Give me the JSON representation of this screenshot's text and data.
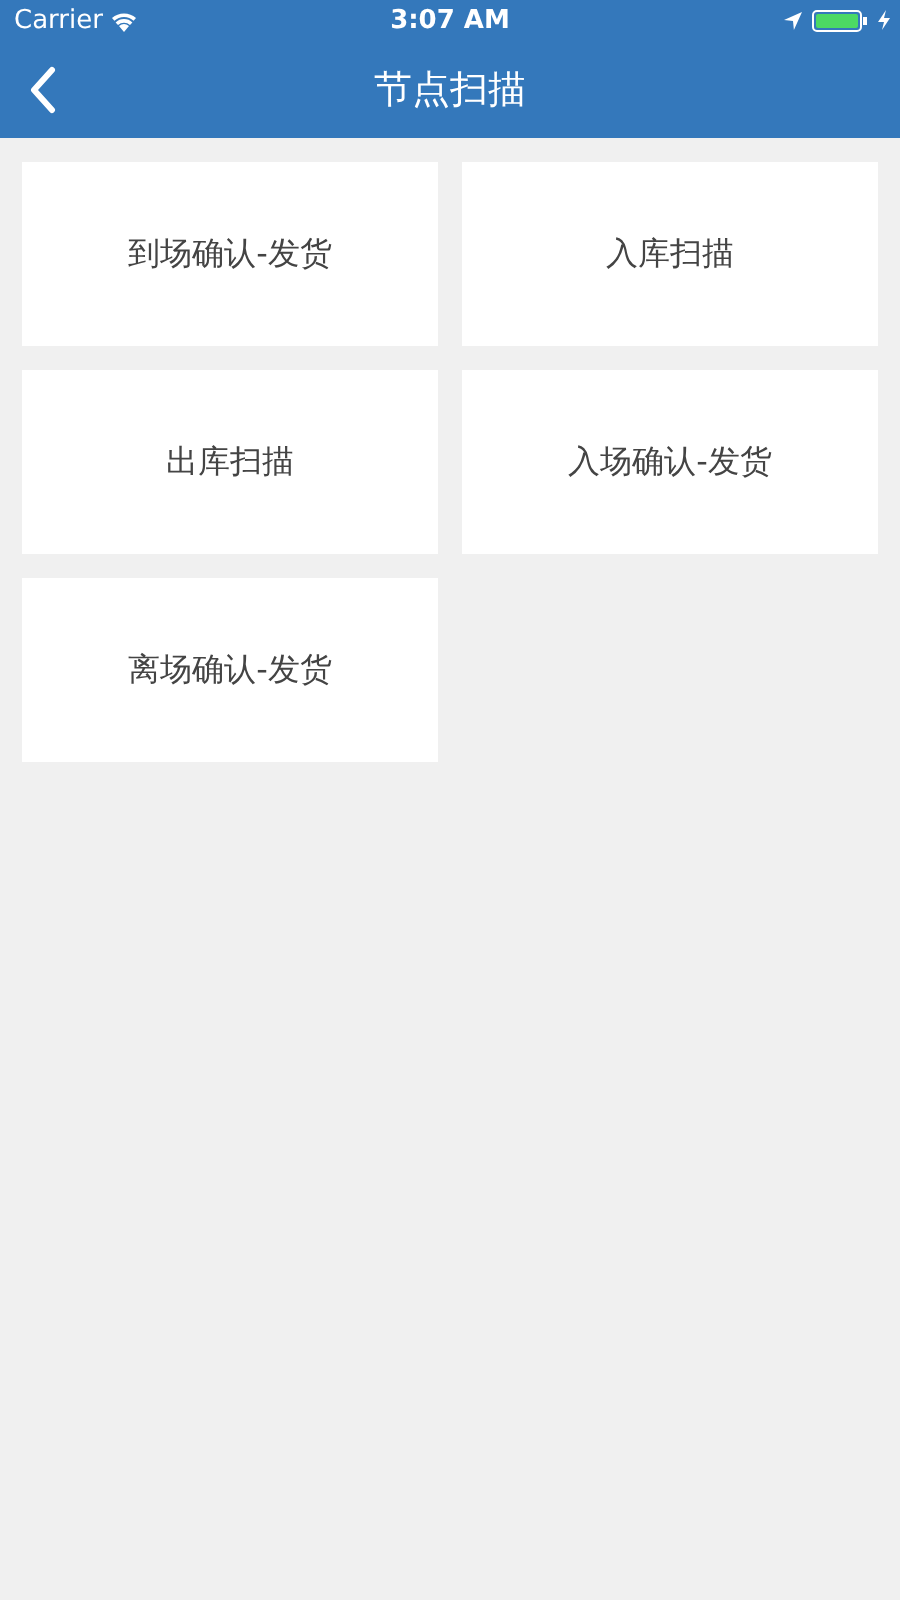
{
  "status_bar": {
    "carrier": "Carrier",
    "time": "3:07 AM"
  },
  "nav_bar": {
    "title": "节点扫描"
  },
  "tiles": [
    {
      "label": "到场确认-发货"
    },
    {
      "label": "入库扫描"
    },
    {
      "label": "出库扫描"
    },
    {
      "label": "入场确认-发货"
    },
    {
      "label": "离场确认-发货"
    }
  ]
}
